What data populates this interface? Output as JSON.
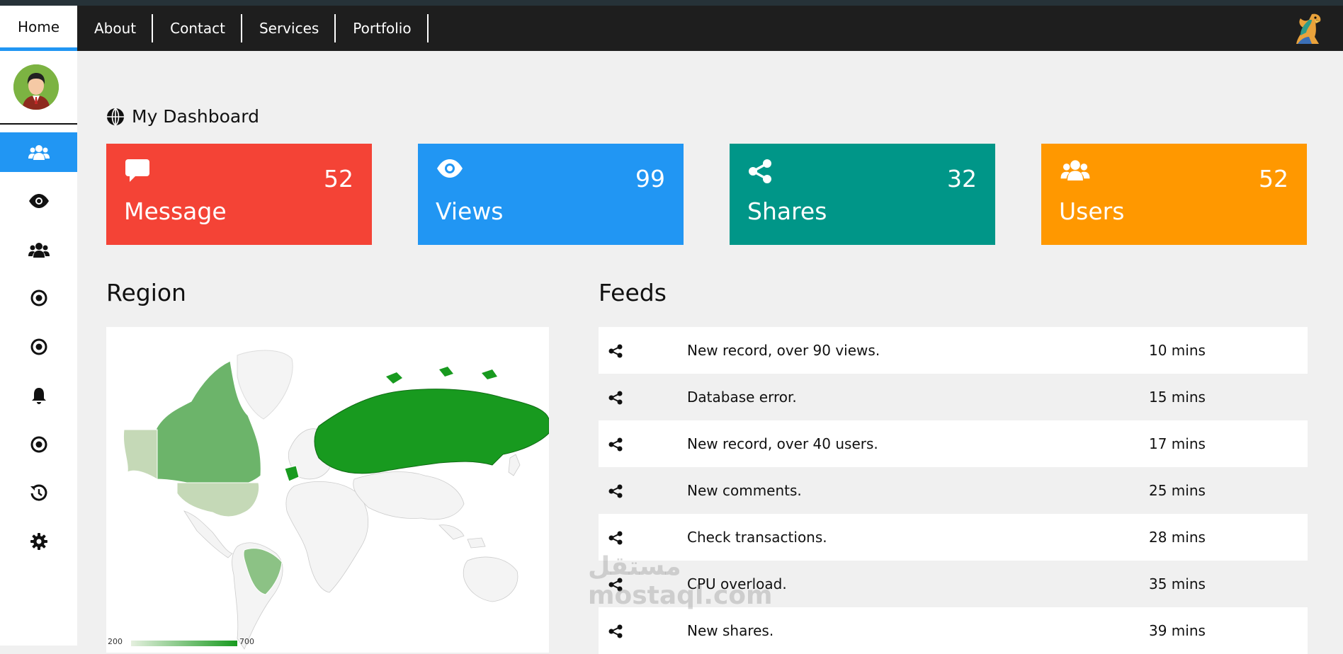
{
  "nav": {
    "items": [
      {
        "label": "Home",
        "active": true
      },
      {
        "label": "About"
      },
      {
        "label": "Contact"
      },
      {
        "label": "Services"
      },
      {
        "label": "Portfolio"
      }
    ]
  },
  "sidebar": {
    "items": [
      {
        "icon": "users-icon",
        "active": true
      },
      {
        "icon": "eye-icon"
      },
      {
        "icon": "users-icon"
      },
      {
        "icon": "bullseye-icon"
      },
      {
        "icon": "bullseye-icon"
      },
      {
        "icon": "bell-icon"
      },
      {
        "icon": "bullseye-icon"
      },
      {
        "icon": "history-icon"
      },
      {
        "icon": "gear-icon"
      }
    ]
  },
  "dashboard": {
    "title": "My Dashboard",
    "cards": [
      {
        "label": "Message",
        "value": "52",
        "icon": "comment-icon",
        "color": "#f44336"
      },
      {
        "label": "Views",
        "value": "99",
        "icon": "eye-icon",
        "color": "#2196f3"
      },
      {
        "label": "Shares",
        "value": "32",
        "icon": "share-icon",
        "color": "#009688"
      },
      {
        "label": "Users",
        "value": "52",
        "icon": "users-icon",
        "color": "#ff9800"
      }
    ]
  },
  "region": {
    "title": "Region",
    "legend_min": "200",
    "legend_max": "700"
  },
  "feeds": {
    "title": "Feeds",
    "rows": [
      {
        "text": "New record, over 90 views.",
        "time": "10 mins"
      },
      {
        "text": "Database error.",
        "time": "15 mins"
      },
      {
        "text": "New record, over 40 users.",
        "time": "17 mins"
      },
      {
        "text": "New comments.",
        "time": "25 mins"
      },
      {
        "text": "Check transactions.",
        "time": "28 mins"
      },
      {
        "text": "CPU overload.",
        "time": "35 mins"
      },
      {
        "text": "New shares.",
        "time": "39 mins"
      }
    ]
  },
  "colors": {
    "accent": "#2196f3",
    "topbar": "#1e1e1e",
    "map_strong": "#189a1f",
    "map_mid": "#6cb46a",
    "map_light": "#c5d9b7"
  },
  "watermark": {
    "text": "mostaql.com",
    "arabic": "مستقل"
  }
}
